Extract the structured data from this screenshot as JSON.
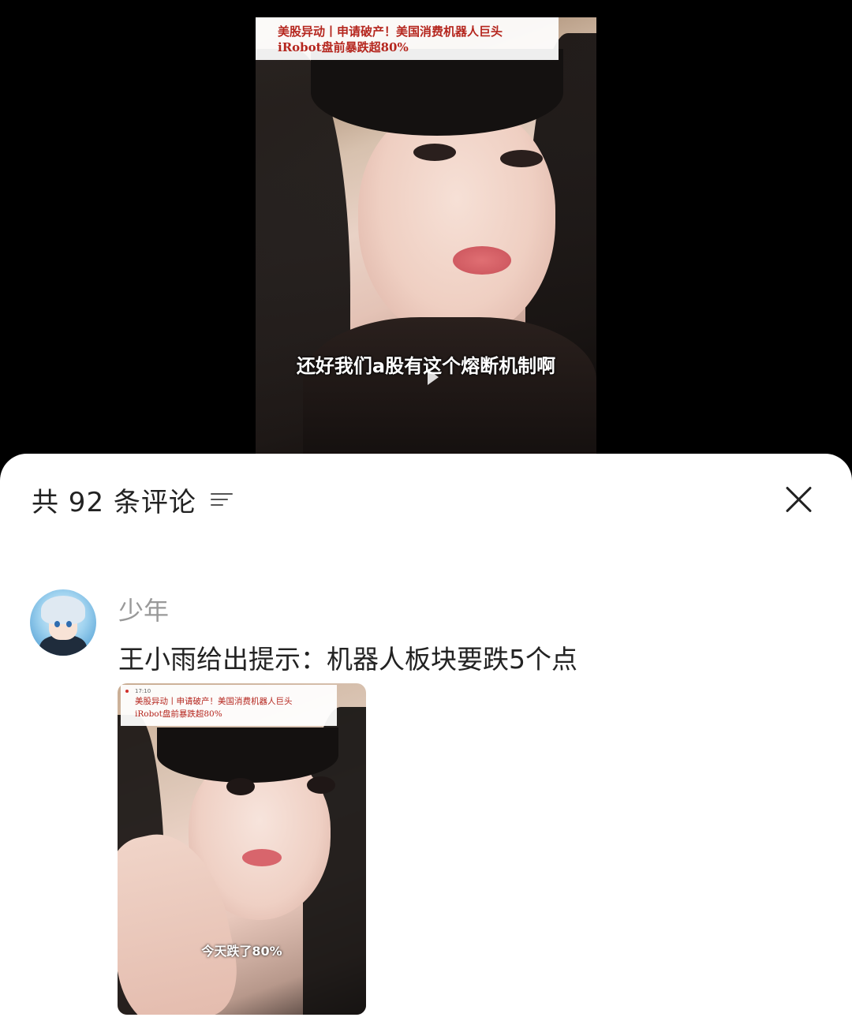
{
  "video": {
    "headline_line1": "美股异动丨申请破产！美国消费机器人巨头",
    "headline_line2": "iRobot盘前暴跌超80%",
    "subtitle": "还好我们a股有这个熔断机制啊"
  },
  "sheet": {
    "count_label": "共 92 条评论",
    "sort_icon": "sort-lines-icon",
    "close_icon": "close-icon"
  },
  "comments": [
    {
      "username": "少年",
      "text": "王小雨给出提示：机器人板块要跌5个点",
      "image": {
        "time": "17:10",
        "headline_line1": "美股异动丨申请破产！美国消费机器人巨头",
        "headline_line2": "iRobot盘前暴跌超80%",
        "subtitle": "今天跌了80%"
      }
    }
  ]
}
